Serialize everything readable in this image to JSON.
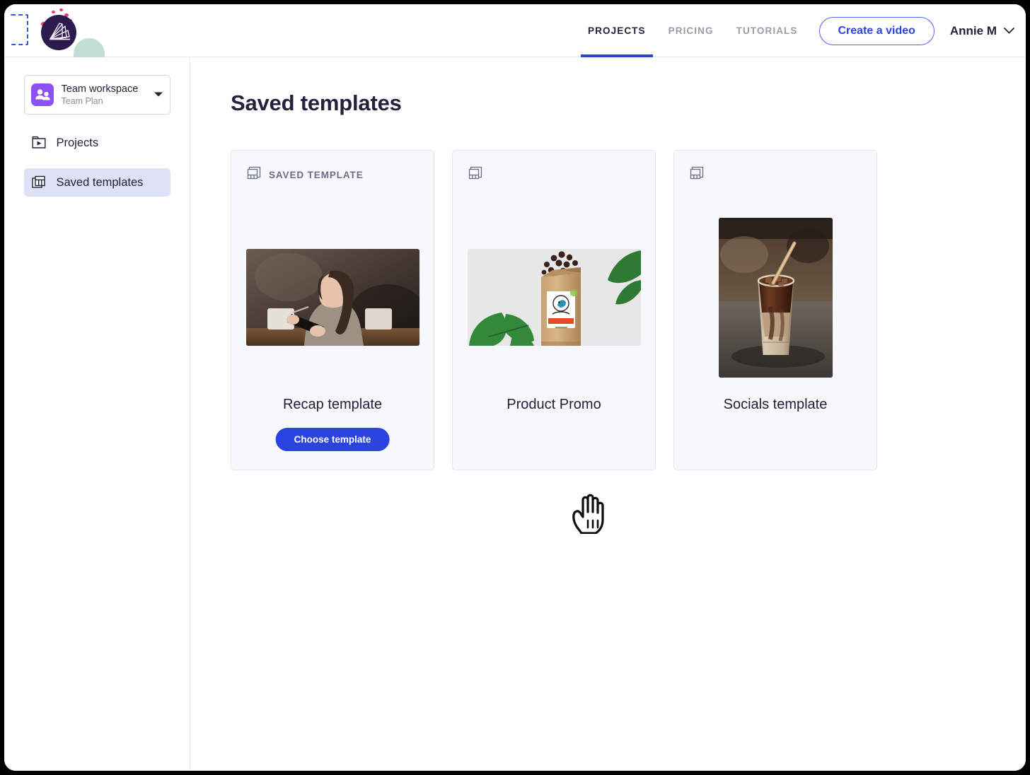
{
  "header": {
    "logo_icon": "wideo-logo-icon",
    "nav": [
      {
        "label": "PROJECTS",
        "active": true
      },
      {
        "label": "PRICING",
        "active": false
      },
      {
        "label": "TUTORIALS",
        "active": false
      }
    ],
    "create_video_label": "Create a video",
    "user_name": "Annie M",
    "user_caret_icon": "chevron-down-icon"
  },
  "sidebar": {
    "workspace": {
      "icon": "team-people-icon",
      "title": "Team workspace",
      "plan": "Team Plan",
      "caret_icon": "caret-down-icon"
    },
    "items": [
      {
        "label": "Projects",
        "icon": "folder-video-icon",
        "active": false
      },
      {
        "label": "Saved templates",
        "icon": "templates-grid-icon",
        "active": true
      }
    ]
  },
  "main": {
    "page_title": "Saved templates",
    "cards": [
      {
        "badge_icon": "template-layout-icon",
        "badge_label": "SAVED TEMPLATE",
        "title": "Recap template",
        "button_label": "Choose template",
        "thumb_orientation": "landscape",
        "thumb_alt": "woman-with-tablet-photo"
      },
      {
        "badge_icon": "template-layout-icon",
        "badge_label": "",
        "title": "Product Promo",
        "button_label": "",
        "thumb_orientation": "landscape",
        "thumb_alt": "coffee-bag-with-leaves-photo"
      },
      {
        "badge_icon": "template-layout-icon",
        "badge_label": "",
        "title": "Socials template",
        "button_label": "",
        "thumb_orientation": "portrait",
        "thumb_alt": "iced-coffee-drink-photo"
      }
    ]
  },
  "cursor": {
    "icon": "pointing-hand-cursor"
  },
  "colors": {
    "accent_blue": "#2b44e0",
    "logo_purple": "#2d1b4e",
    "workspace_purple": "#8b51f4",
    "card_bg": "#f7f8fd",
    "active_nav_bg": "#dfe2f7",
    "confetti_pink": "#f2356b",
    "blob_green": "#c3ded5",
    "text_dark": "#22223a",
    "text_muted": "#8a8a99"
  }
}
